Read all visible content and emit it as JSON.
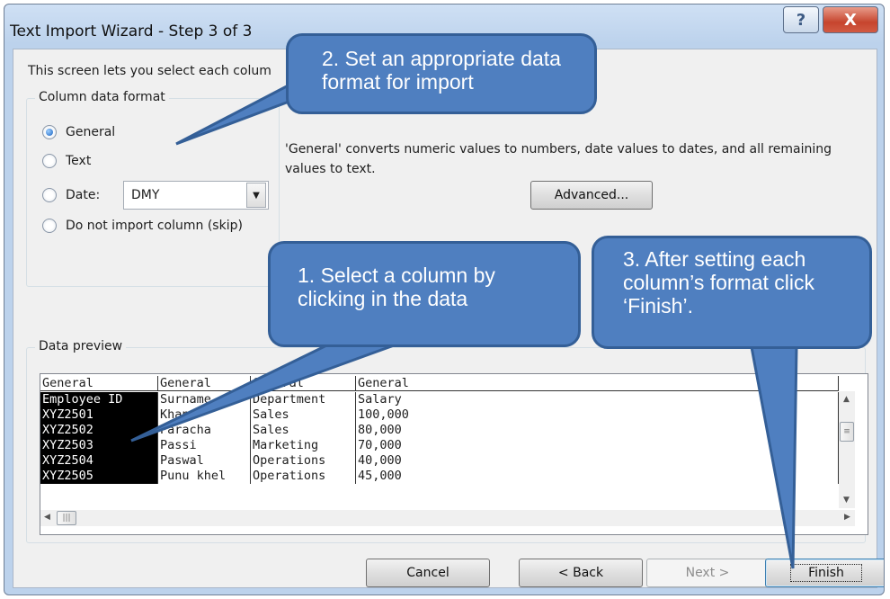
{
  "window": {
    "title": "Text Import Wizard - Step 3 of 3",
    "help_icon": "question-mark-icon",
    "help_glyph": "?",
    "close_icon": "close-x-icon",
    "close_glyph": "X"
  },
  "description": "This screen lets you select each colum",
  "column_format": {
    "group_label": "Column data format",
    "options": [
      {
        "label": "General",
        "checked": true
      },
      {
        "label": "Text",
        "checked": false
      },
      {
        "label": "Date:",
        "checked": false
      },
      {
        "label": "Do not import column (skip)",
        "checked": false
      }
    ],
    "date_value": "DMY"
  },
  "info_text": "'General' converts numeric values to numbers, date values to dates, and all remaining values to text.",
  "advanced_label": "Advanced...",
  "preview": {
    "label": "Data preview",
    "header": [
      "General",
      "General",
      "General",
      "General"
    ],
    "rows": [
      [
        "Employee ID",
        "Surname",
        "Department",
        "Salary"
      ],
      [
        "XYZ2501",
        "Khan",
        "Sales",
        "100,000"
      ],
      [
        "XYZ2502",
        "Paracha",
        "Sales",
        "80,000"
      ],
      [
        "XYZ2503",
        "Passi",
        "Marketing",
        "70,000"
      ],
      [
        "XYZ2504",
        "Paswal",
        "Operations",
        "40,000"
      ],
      [
        "XYZ2505",
        "Punu khel",
        "Operations",
        "45,000"
      ]
    ],
    "selected_column": 0
  },
  "buttons": {
    "cancel": "Cancel",
    "back": "< Back",
    "next": "Next >",
    "finish": "Finish"
  },
  "callouts": {
    "c1": "1. Select a column by clicking in the data",
    "c2": "2. Set an appropriate data format for import",
    "c3": "3. After setting each column’s format click ‘Finish’.",
    "fill": "#4f7fc0",
    "border": "#345f97"
  }
}
